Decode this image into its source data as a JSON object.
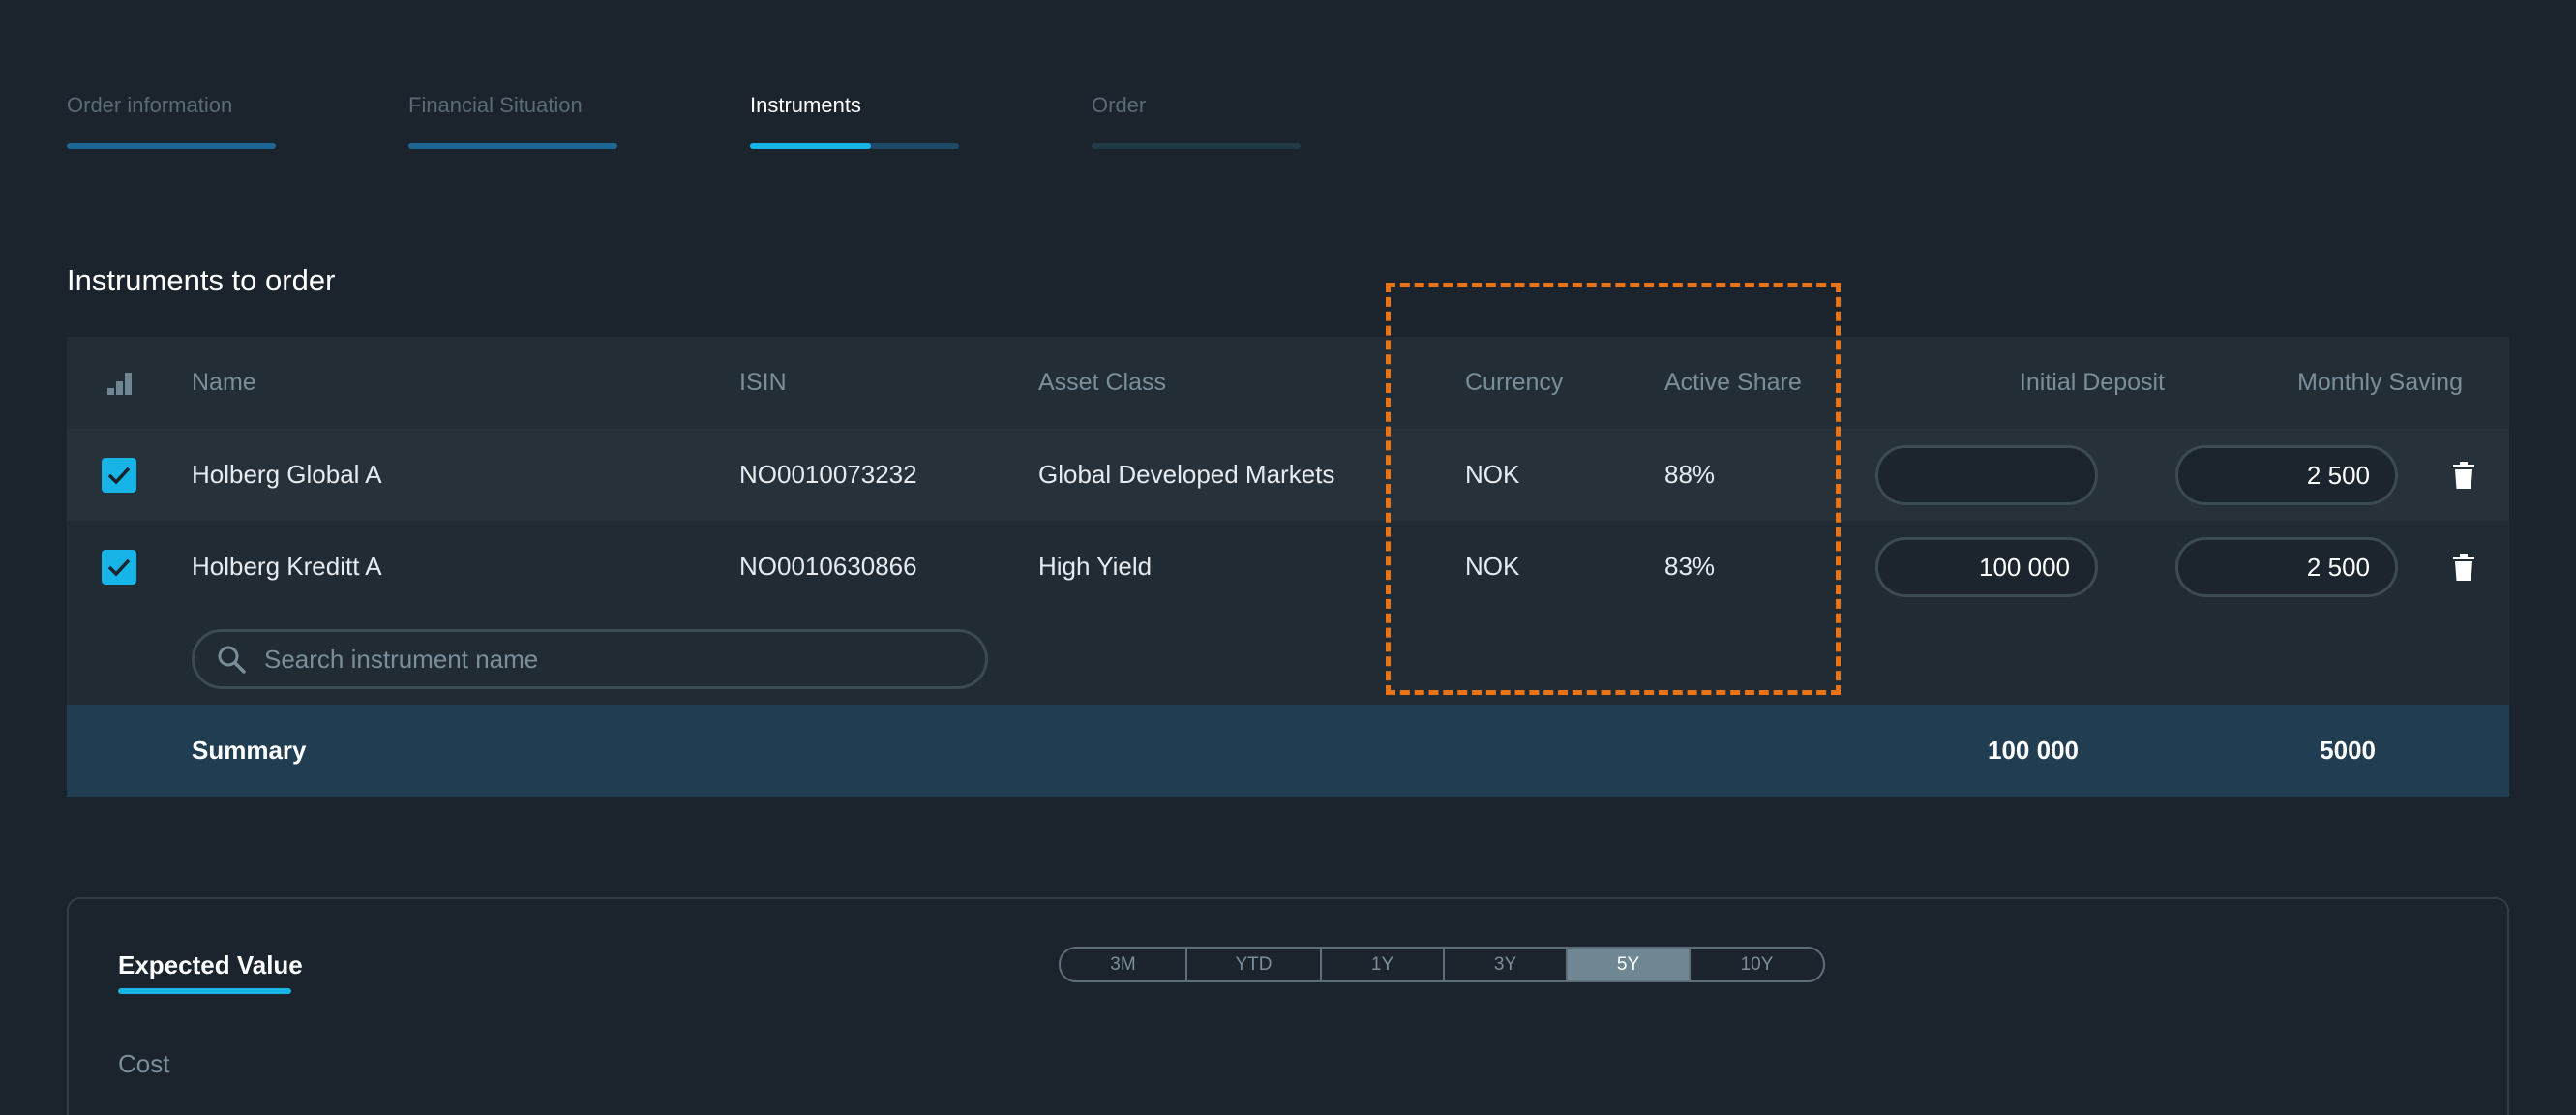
{
  "stepper": [
    {
      "label": "Order information",
      "state": "done"
    },
    {
      "label": "Financial Situation",
      "state": "done"
    },
    {
      "label": "Instruments",
      "state": "active",
      "progress": 0.58
    },
    {
      "label": "Order",
      "state": "pending"
    }
  ],
  "section_title": "Instruments to order",
  "table": {
    "headers": {
      "name": "Name",
      "isin": "ISIN",
      "asset_class": "Asset Class",
      "currency": "Currency",
      "active_share": "Active Share",
      "initial_deposit": "Initial Deposit",
      "monthly_saving": "Monthly Saving"
    },
    "rows": [
      {
        "checked": true,
        "name": "Holberg Global A",
        "isin": "NO0010073232",
        "asset_class": "Global Developed Markets",
        "currency": "NOK",
        "active_share": "88%",
        "initial_deposit": "",
        "monthly_saving": "2 500"
      },
      {
        "checked": true,
        "name": "Holberg Kreditt A",
        "isin": "NO0010630866",
        "asset_class": "High Yield",
        "currency": "NOK",
        "active_share": "83%",
        "initial_deposit": "100 000",
        "monthly_saving": "2 500"
      }
    ],
    "search_placeholder": "Search instrument name",
    "summary": {
      "label": "Summary",
      "initial_deposit": "100 000",
      "monthly_saving": "5000"
    }
  },
  "panel": {
    "tab": "Expected Value",
    "cost_label": "Cost",
    "ranges": [
      "3M",
      "YTD",
      "1Y",
      "3Y",
      "5Y",
      "10Y"
    ],
    "selected_range": "5Y"
  },
  "colors": {
    "accent": "#17b4e8",
    "highlight": "#ea7316",
    "background": "#1b232c"
  }
}
